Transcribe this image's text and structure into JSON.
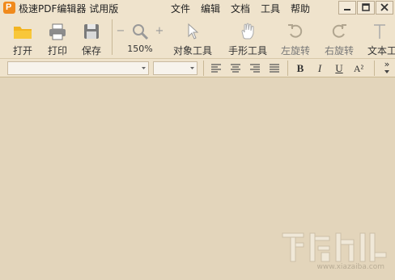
{
  "window": {
    "title": "极速PDF编辑器 试用版",
    "app_icon_letter": "P"
  },
  "menu": [
    "文件",
    "编辑",
    "文档",
    "工具",
    "帮助"
  ],
  "toolbar": {
    "open": "打开",
    "print": "打印",
    "save": "保存",
    "zoom": "150%",
    "zoom_out": "−",
    "zoom_in": "+",
    "object_tool": "对象工具",
    "hand_tool": "手形工具",
    "rotate_left": "左旋转",
    "rotate_right": "右旋转",
    "text_tool": "文本工"
  },
  "format": {
    "font_family": "",
    "font_size": "",
    "bold": "B",
    "italic": "I",
    "underline": "U",
    "superscript": "A²",
    "overflow": "»"
  },
  "watermark": {
    "url": "www.xiazaiba.com"
  }
}
